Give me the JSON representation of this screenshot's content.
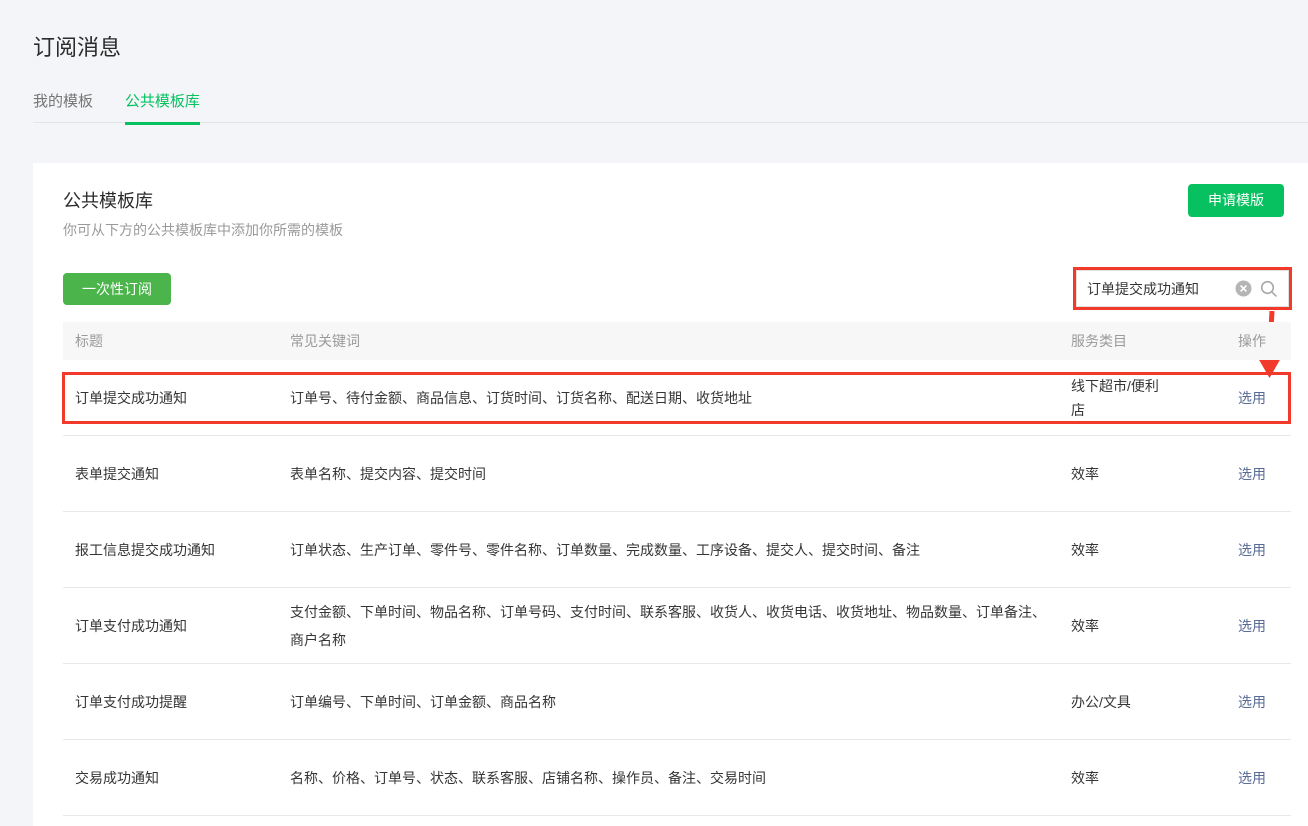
{
  "page": {
    "title": "订阅消息"
  },
  "tabs": [
    {
      "label": "我的模板",
      "active": false
    },
    {
      "label": "公共模板库",
      "active": true
    }
  ],
  "panel": {
    "title": "公共模板库",
    "subtitle": "你可从下方的公共模板库中添加你所需的模板",
    "apply_button_label": "申请模版",
    "once_subscribe_button_label": "一次性订阅"
  },
  "search": {
    "value": "订单提交成功通知",
    "clear_icon": "circle-x-icon",
    "search_icon": "magnifier-icon"
  },
  "table": {
    "headers": {
      "title": "标题",
      "keywords": "常见关键词",
      "category": "服务类目",
      "action": "操作"
    },
    "rows": [
      {
        "title": "订单提交成功通知",
        "keywords": "订单号、待付金额、商品信息、订货时间、订货名称、配送日期、收货地址",
        "category": "线下超市/便利店",
        "action": "选用",
        "highlighted": true
      },
      {
        "title": "表单提交通知",
        "keywords": "表单名称、提交内容、提交时间",
        "category": "效率",
        "action": "选用",
        "highlighted": false
      },
      {
        "title": "报工信息提交成功通知",
        "keywords": "订单状态、生产订单、零件号、零件名称、订单数量、完成数量、工序设备、提交人、提交时间、备注",
        "category": "效率",
        "action": "选用",
        "highlighted": false
      },
      {
        "title": "订单支付成功通知",
        "keywords": "支付金额、下单时间、物品名称、订单号码、支付时间、联系客服、收货人、收货电话、收货地址、物品数量、订单备注、商户名称",
        "category": "效率",
        "action": "选用",
        "highlighted": false
      },
      {
        "title": "订单支付成功提醒",
        "keywords": "订单编号、下单时间、订单金额、商品名称",
        "category": "办公/文具",
        "action": "选用",
        "highlighted": false
      },
      {
        "title": "交易成功通知",
        "keywords": "名称、价格、订单号、状态、联系客服、店铺名称、操作员、备注、交易时间",
        "category": "效率",
        "action": "选用",
        "highlighted": false
      }
    ]
  },
  "annotations": {
    "highlight_color": "#f13a2a",
    "highlighted_search_value": "订单提交成功通知",
    "arrow": "red-arrow-from-search-to-first-row"
  },
  "colors": {
    "accent_green": "#07c160",
    "button_green": "#4bb54b",
    "link_blue": "#576b95",
    "page_background": "#f4f5f8",
    "muted_text": "#9a9a9a"
  }
}
